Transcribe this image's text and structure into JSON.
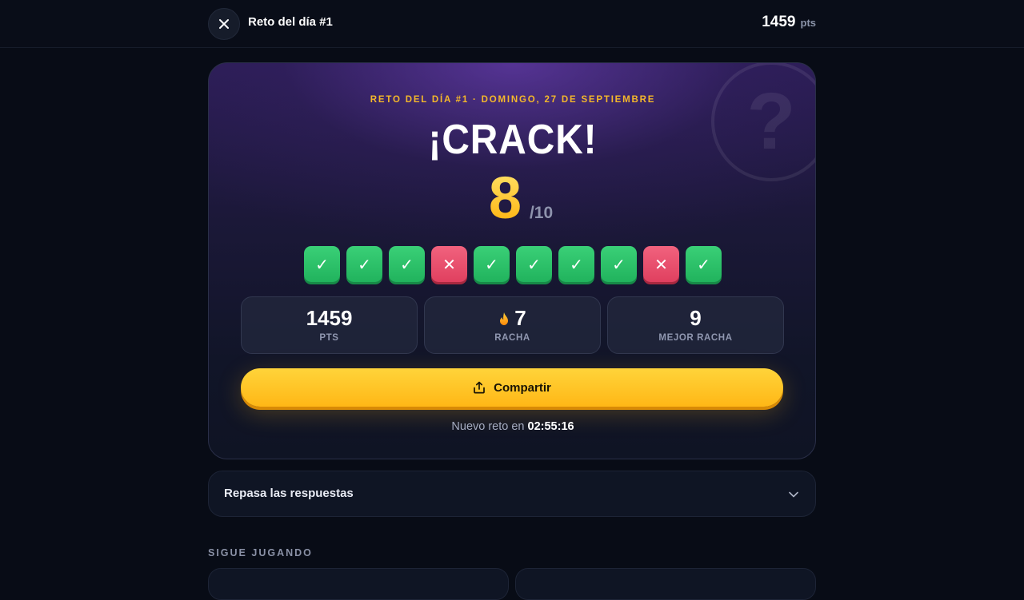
{
  "topbar": {
    "title": "Reto del día #1",
    "score": "1459",
    "score_unit": "pts",
    "close_icon": "close-icon"
  },
  "result": {
    "subtitle": "RETO DEL DÍA #1 · DOMINGO, 27 DE SEPTIEMBRE",
    "headline": "¡CRACK!",
    "score": "8",
    "total": "/10",
    "answers": [
      {
        "correct": true,
        "glyph": "✓"
      },
      {
        "correct": true,
        "glyph": "✓"
      },
      {
        "correct": true,
        "glyph": "✓"
      },
      {
        "correct": false,
        "glyph": "✕"
      },
      {
        "correct": true,
        "glyph": "✓"
      },
      {
        "correct": true,
        "glyph": "✓"
      },
      {
        "correct": true,
        "glyph": "✓"
      },
      {
        "correct": true,
        "glyph": "✓"
      },
      {
        "correct": false,
        "glyph": "✕"
      },
      {
        "correct": true,
        "glyph": "✓"
      }
    ],
    "decor_icon": "question-mark-icon"
  },
  "stats": [
    {
      "value": "1459",
      "label": "PTS"
    },
    {
      "value": "7",
      "label": "RACHA",
      "icon": "flame-icon"
    },
    {
      "value": "9",
      "label": "MEJOR RACHA"
    }
  ],
  "share": {
    "label": "Compartir",
    "icon": "share-icon"
  },
  "next_challenge": {
    "prefix": "Nuevo reto en ",
    "time": "02:55:16"
  },
  "review": {
    "label": "Repasa las respuestas",
    "icon": "chevron-down-icon"
  },
  "more": {
    "title": "SIGUE JUGANDO"
  },
  "colors": {
    "accent": "#ffc21a",
    "correct": "#2bc36a",
    "wrong": "#e94a68",
    "background": "#080c16"
  }
}
